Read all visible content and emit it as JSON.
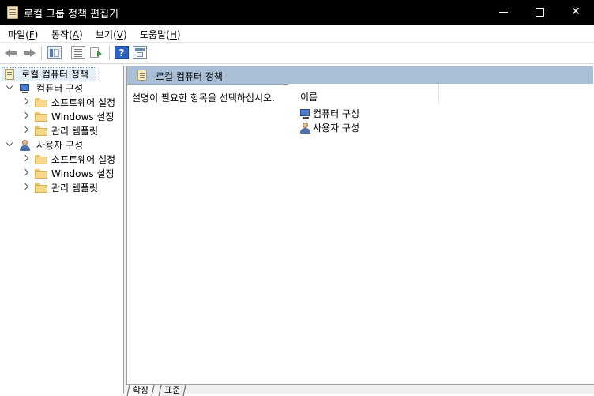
{
  "window": {
    "title": "로컬 그룹 정책 편집기",
    "controls": {
      "minimize": "minimize-icon",
      "maximize": "maximize-icon",
      "close": "✕"
    }
  },
  "menu": {
    "items": [
      {
        "label": "파일(F)",
        "pre": "파일(",
        "key": "F",
        "post": ")"
      },
      {
        "label": "동작(A)",
        "pre": "동작(",
        "key": "A",
        "post": ")"
      },
      {
        "label": "보기(V)",
        "pre": "보기(",
        "key": "V",
        "post": ")"
      },
      {
        "label": "도움말(H)",
        "pre": "도움말(",
        "key": "H",
        "post": ")"
      }
    ]
  },
  "toolbar": {
    "icons": [
      "back-arrow-icon",
      "forward-arrow-icon",
      "show-hide-tree-icon",
      "properties-icon",
      "export-list-icon",
      "help-icon",
      "filter-icon"
    ],
    "help_glyph": "?"
  },
  "tree": {
    "root": "로컬 컴퓨터 정책",
    "computer": {
      "label": "컴퓨터 구성",
      "children": [
        "소프트웨어 설정",
        "Windows 설정",
        "관리 템플릿"
      ]
    },
    "user": {
      "label": "사용자 구성",
      "children": [
        "소프트웨어 설정",
        "Windows 설정",
        "관리 템플릿"
      ]
    }
  },
  "content": {
    "header": "로컬 컴퓨터 정책",
    "description": "설명이 필요한 항목을 선택하십시오.",
    "column_name": "이름",
    "items": [
      "컴퓨터 구성",
      "사용자 구성"
    ]
  },
  "tabs": [
    "확장",
    "표준"
  ],
  "colors": {
    "header_band": "#a9bfd6",
    "selection": "#e5f0fb",
    "folder": "#f5d98a"
  }
}
